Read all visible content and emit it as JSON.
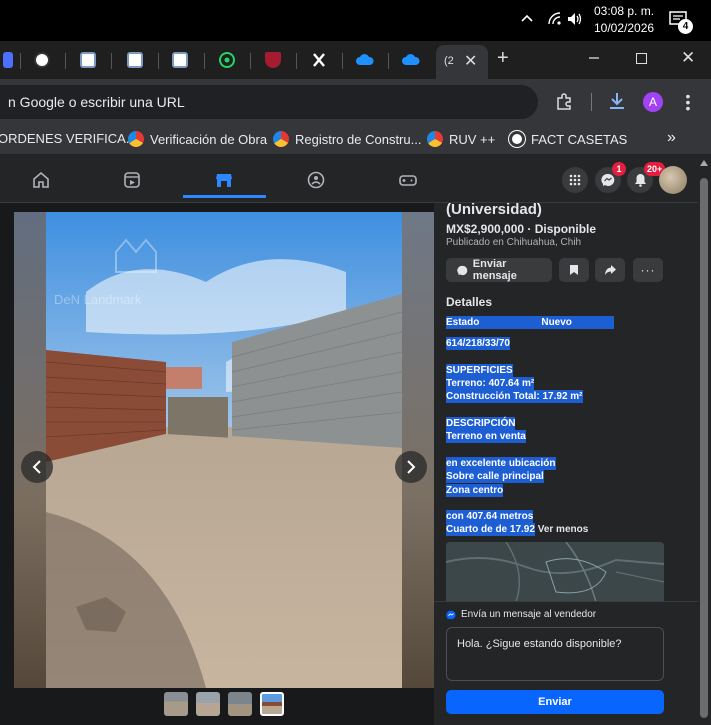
{
  "taskbar": {
    "time": "03:08 p. m.",
    "date": "10/02/2026",
    "notification_count": "4"
  },
  "browser": {
    "active_tab_label": "(2",
    "omnibox_text": "n Google o escribir una URL",
    "profile_initial": "A",
    "bookmarks": [
      {
        "label": "ORDENES VERIFICA..."
      },
      {
        "label": "Verificación de Obra"
      },
      {
        "label": "Registro de Constru..."
      },
      {
        "label": "RUV ++"
      },
      {
        "label": "FACT CASETAS"
      }
    ]
  },
  "fb": {
    "messenger_badge": "1",
    "notifications_badge": "20+"
  },
  "listing": {
    "title": "(Universidad)",
    "price": "MX$2,900,000 · Disponible",
    "published": "Publicado en Chihuahua, Chih",
    "send_message_label": "Enviar mensaje",
    "details_heading": "Detalles",
    "estado_label": "Estado",
    "estado_value": "Nuevo",
    "phone": "614/218/33/70",
    "superficies": "SUPERFICIES",
    "terreno": "Terreno: 407.64 m²",
    "construccion": "Construcción Total: 17.92 m²",
    "descripcion": "DESCRIPCIÓN",
    "desc_1": "Terreno en venta",
    "desc_2": "en excelente ubicación",
    "desc_3": "Sobre calle  principal",
    "desc_4": "Zona centro",
    "desc_5": "con 407.64 metros",
    "desc_6": "Cuarto de de 17.92",
    "ver_menos": "Ver menos",
    "watermark": "DeN Landmark"
  },
  "seller_message": {
    "heading": "Envía un mensaje al vendedor",
    "text": "Hola. ¿Sigue estando disponible?",
    "send_label": "Enviar"
  },
  "colors": {
    "fb_blue": "#0866ff",
    "selection": "#1d5ed3",
    "badge_red": "#e41e3f"
  }
}
